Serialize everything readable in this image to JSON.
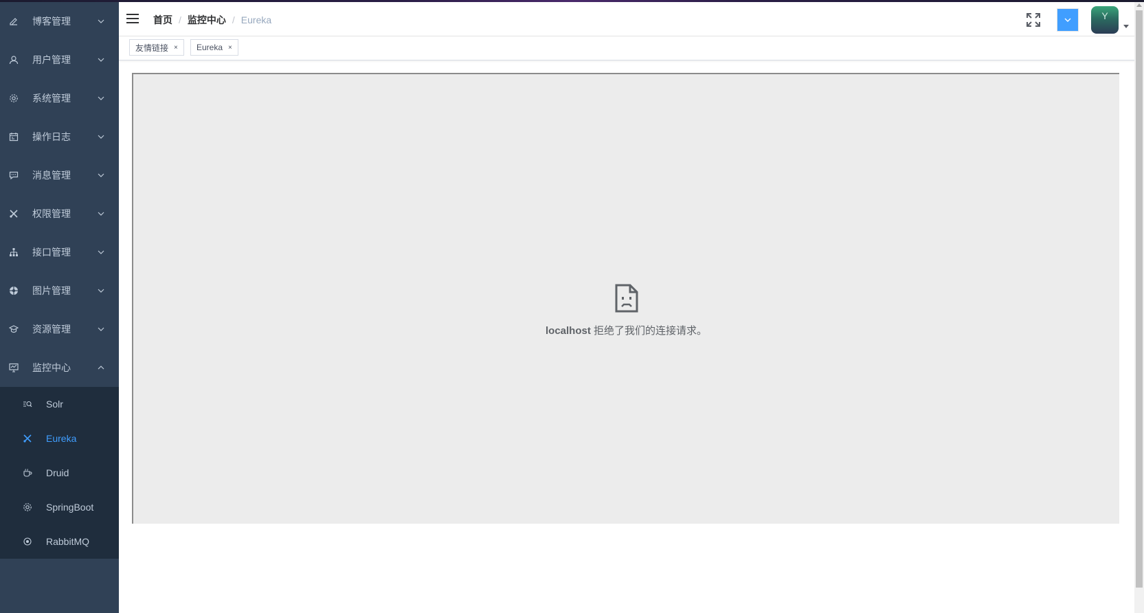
{
  "sidebar": {
    "menus": [
      {
        "label": "博客管理",
        "icon": "edit-icon"
      },
      {
        "label": "用户管理",
        "icon": "user-icon"
      },
      {
        "label": "系统管理",
        "icon": "gear-icon"
      },
      {
        "label": "操作日志",
        "icon": "calendar-icon"
      },
      {
        "label": "消息管理",
        "icon": "message-icon"
      },
      {
        "label": "权限管理",
        "icon": "scissors-icon"
      },
      {
        "label": "接口管理",
        "icon": "sitemap-icon"
      },
      {
        "label": "图片管理",
        "icon": "aperture-icon"
      },
      {
        "label": "资源管理",
        "icon": "graduation-cap-icon"
      },
      {
        "label": "监控中心",
        "icon": "monitor-icon",
        "expanded": true
      }
    ],
    "submenu": [
      {
        "label": "Solr",
        "icon": "search-list-icon"
      },
      {
        "label": "Eureka",
        "icon": "scissors-icon",
        "active": true
      },
      {
        "label": "Druid",
        "icon": "coffee-icon"
      },
      {
        "label": "SpringBoot",
        "icon": "gear-icon"
      },
      {
        "label": "RabbitMQ",
        "icon": "target-icon"
      }
    ]
  },
  "navbar": {
    "breadcrumb": [
      "首页",
      "监控中心",
      "Eureka"
    ],
    "avatar_letter": "Y"
  },
  "tags": [
    {
      "label": "友情链接",
      "close": "×"
    },
    {
      "label": "Eureka",
      "close": "×"
    }
  ],
  "frame": {
    "host": "localhost",
    "message": " 拒绝了我们的连接请求。"
  },
  "colors": {
    "sidebar_bg": "#304156",
    "submenu_bg": "#1f2d3d",
    "accent": "#409eff",
    "menu_text": "#bfcbd9"
  }
}
